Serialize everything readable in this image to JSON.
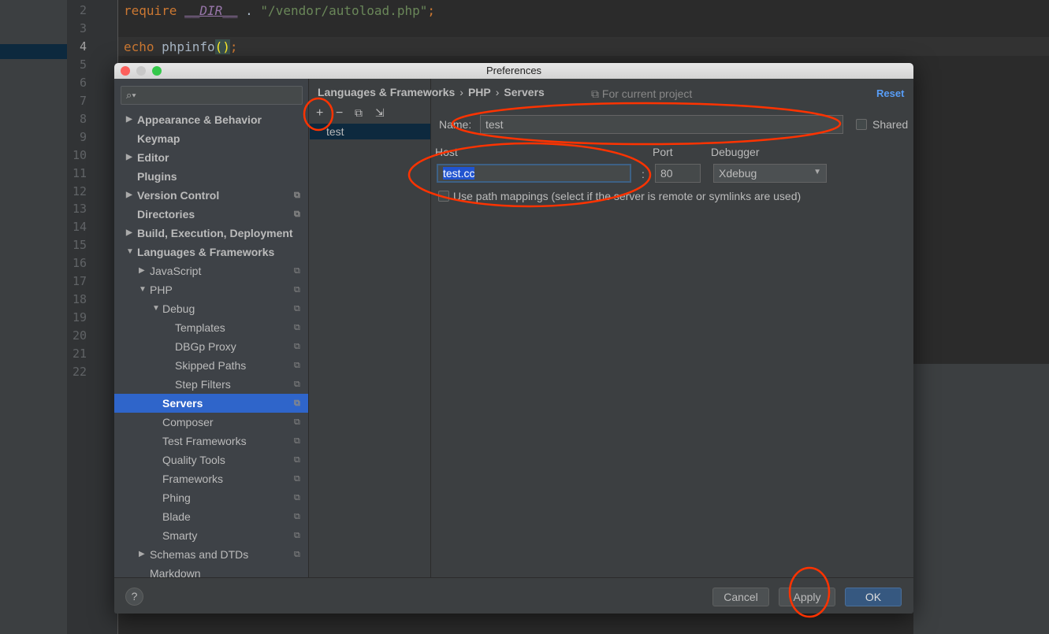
{
  "editor": {
    "line_numbers": [
      "2",
      "3",
      "4",
      "5",
      "6",
      "7",
      "8",
      "9",
      "10",
      "11",
      "12",
      "13",
      "14",
      "15",
      "16",
      "17",
      "18",
      "19",
      "20",
      "21",
      "22"
    ],
    "current_line": "4",
    "line2": {
      "kw": "require",
      "const": "__DIR__",
      "dot": " . ",
      "str": "\"/vendor/autoload.php\"",
      "end": ";"
    },
    "line4": {
      "kw": "echo",
      "fn": " phpinfo",
      "paren": "()",
      "end": ";"
    }
  },
  "dialog": {
    "title": "Preferences",
    "search_placeholder": "",
    "sidebar": [
      {
        "label": "Appearance & Behavior",
        "level": 0,
        "arrow": "▶",
        "bold": true
      },
      {
        "label": "Keymap",
        "level": 0,
        "bold": true
      },
      {
        "label": "Editor",
        "level": 0,
        "arrow": "▶",
        "bold": true
      },
      {
        "label": "Plugins",
        "level": 0,
        "bold": true
      },
      {
        "label": "Version Control",
        "level": 0,
        "arrow": "▶",
        "bold": true,
        "copy": true
      },
      {
        "label": "Directories",
        "level": 0,
        "bold": true,
        "copy": true
      },
      {
        "label": "Build, Execution, Deployment",
        "level": 0,
        "arrow": "▶",
        "bold": true
      },
      {
        "label": "Languages & Frameworks",
        "level": 0,
        "arrow": "▼",
        "bold": true
      },
      {
        "label": "JavaScript",
        "level": 1,
        "arrow": "▶",
        "copy": true
      },
      {
        "label": "PHP",
        "level": 1,
        "arrow": "▼",
        "copy": true
      },
      {
        "label": "Debug",
        "level": 2,
        "arrow": "▼",
        "copy": true
      },
      {
        "label": "Templates",
        "level": 3,
        "copy": true
      },
      {
        "label": "DBGp Proxy",
        "level": 3,
        "copy": true
      },
      {
        "label": "Skipped Paths",
        "level": 3,
        "copy": true
      },
      {
        "label": "Step Filters",
        "level": 3,
        "copy": true
      },
      {
        "label": "Servers",
        "level": 2,
        "copy": true,
        "selected": true
      },
      {
        "label": "Composer",
        "level": 2,
        "copy": true
      },
      {
        "label": "Test Frameworks",
        "level": 2,
        "copy": true
      },
      {
        "label": "Quality Tools",
        "level": 2,
        "copy": true
      },
      {
        "label": "Frameworks",
        "level": 2,
        "copy": true
      },
      {
        "label": "Phing",
        "level": 2,
        "copy": true
      },
      {
        "label": "Blade",
        "level": 2,
        "copy": true
      },
      {
        "label": "Smarty",
        "level": 2,
        "copy": true
      },
      {
        "label": "Schemas and DTDs",
        "level": 1,
        "arrow": "▶",
        "copy": true
      },
      {
        "label": "Markdown",
        "level": 1
      }
    ],
    "breadcrumb": [
      "Languages & Frameworks",
      "›",
      "PHP",
      "›",
      "Servers"
    ],
    "scope": "For current project",
    "reset": "Reset",
    "toolbar": {
      "add": "+",
      "remove": "−",
      "copy": "⧉",
      "import": "⇲"
    },
    "servers": [
      "test"
    ],
    "form": {
      "name_label": "Name:",
      "name_value": "test",
      "shared_label": "Shared",
      "shared_checked": false,
      "host_label": "Host",
      "host_value": "test.cc",
      "port_label": "Port",
      "port_value": "80",
      "colon": ":",
      "debugger_label": "Debugger",
      "debugger_value": "Xdebug",
      "path_mappings_label": "Use path mappings (select if the server is remote or symlinks are used)",
      "path_mappings_checked": false
    },
    "footer": {
      "help": "?",
      "cancel": "Cancel",
      "apply": "Apply",
      "ok": "OK"
    }
  },
  "colors": {
    "accent": "#2f65ca",
    "ok_button": "#365880",
    "annotation": "#ff3300",
    "link": "#589df6"
  }
}
